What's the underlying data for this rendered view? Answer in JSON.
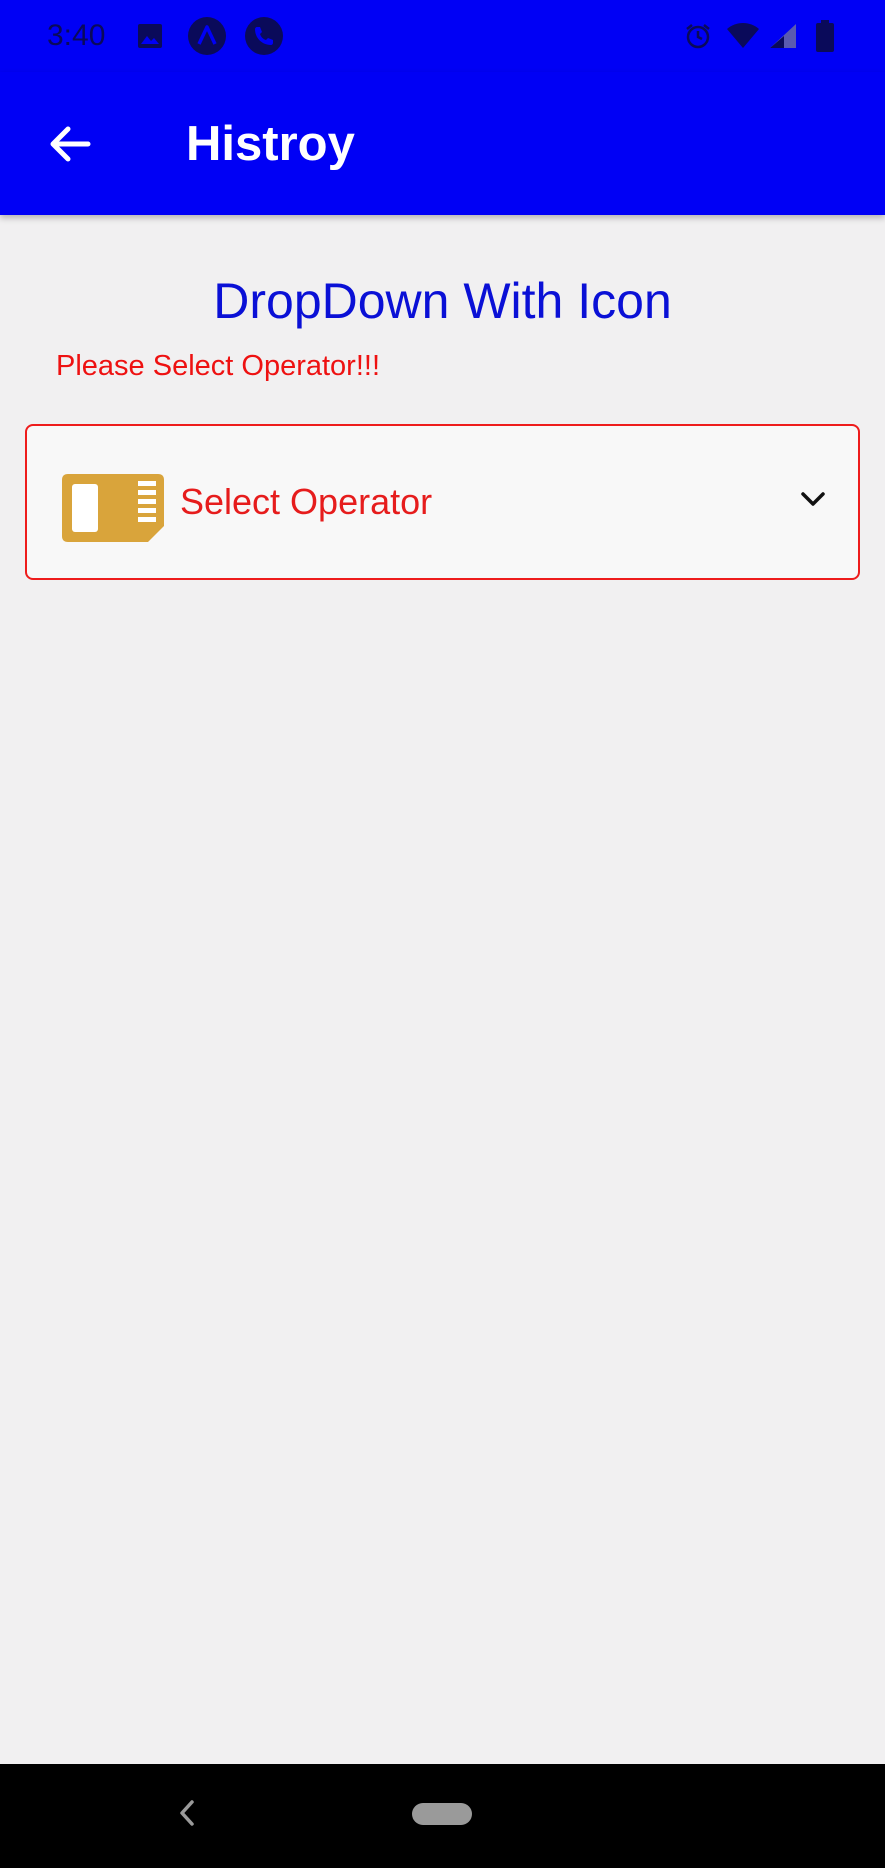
{
  "status_bar": {
    "time": "3:40",
    "icons": [
      "image-icon",
      "app-icon",
      "phone-icon",
      "alarm-icon",
      "wifi-icon",
      "signal-icon",
      "battery-icon"
    ]
  },
  "app_bar": {
    "title": "Histroy",
    "back_icon": "arrow-back-icon"
  },
  "main": {
    "heading": "DropDown With Icon",
    "error_message": "Please Select Operator!!!",
    "dropdown": {
      "placeholder": "Select Operator",
      "leading_icon": "sim-card-icon",
      "trailing_icon": "chevron-down-icon"
    }
  },
  "nav_bar": {
    "icons": [
      "nav-back-icon",
      "home-pill-icon"
    ]
  },
  "colors": {
    "app_bar": "#0000f5",
    "heading": "#0a10d6",
    "error": "#ee1111",
    "sim_icon": "#d9a43b",
    "background": "#f1f0f1"
  }
}
